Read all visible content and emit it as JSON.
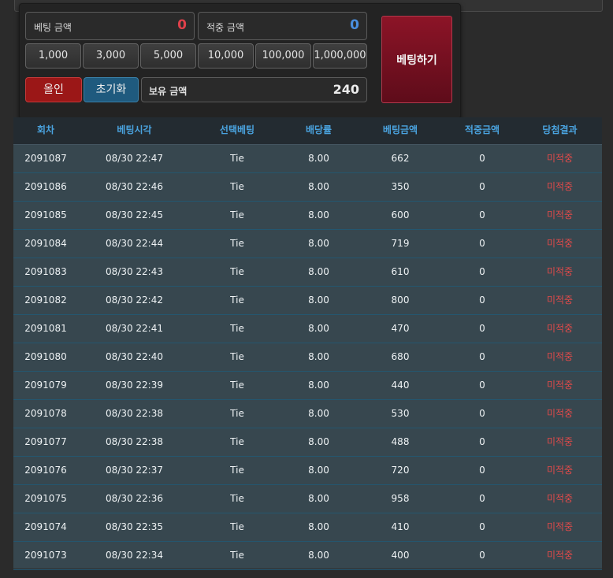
{
  "bet_form": {
    "bet_amount_label": "베팅 금액",
    "bet_amount_value": "0",
    "win_amount_label": "적중 금액",
    "win_amount_value": "0",
    "chips": [
      "1,000",
      "3,000",
      "5,000",
      "10,000",
      "100,000",
      "1,000,000"
    ],
    "allin_label": "올인",
    "reset_label": "초기화",
    "holding_label": "보유 금액",
    "holding_value": "240",
    "place_bet_label": "베팅하기",
    "colors": {
      "bet_amount": "#e0404a",
      "win_amount": "#4a8fe0",
      "place_bet": "#7a1020"
    }
  },
  "history": {
    "headers": [
      "회차",
      "베팅시각",
      "선택베팅",
      "배당률",
      "베팅금액",
      "적중금액",
      "당첨결과"
    ],
    "rows": [
      [
        "2091087",
        "08/30 22:47",
        "Tie",
        "8.00",
        "662",
        "0",
        "미적중"
      ],
      [
        "2091086",
        "08/30 22:46",
        "Tie",
        "8.00",
        "350",
        "0",
        "미적중"
      ],
      [
        "2091085",
        "08/30 22:45",
        "Tie",
        "8.00",
        "600",
        "0",
        "미적중"
      ],
      [
        "2091084",
        "08/30 22:44",
        "Tie",
        "8.00",
        "719",
        "0",
        "미적중"
      ],
      [
        "2091083",
        "08/30 22:43",
        "Tie",
        "8.00",
        "610",
        "0",
        "미적중"
      ],
      [
        "2091082",
        "08/30 22:42",
        "Tie",
        "8.00",
        "800",
        "0",
        "미적중"
      ],
      [
        "2091081",
        "08/30 22:41",
        "Tie",
        "8.00",
        "470",
        "0",
        "미적중"
      ],
      [
        "2091080",
        "08/30 22:40",
        "Tie",
        "8.00",
        "680",
        "0",
        "미적중"
      ],
      [
        "2091079",
        "08/30 22:39",
        "Tie",
        "8.00",
        "440",
        "0",
        "미적중"
      ],
      [
        "2091078",
        "08/30 22:38",
        "Tie",
        "8.00",
        "530",
        "0",
        "미적중"
      ],
      [
        "2091077",
        "08/30 22:38",
        "Tie",
        "8.00",
        "488",
        "0",
        "미적중"
      ],
      [
        "2091076",
        "08/30 22:37",
        "Tie",
        "8.00",
        "720",
        "0",
        "미적중"
      ],
      [
        "2091075",
        "08/30 22:36",
        "Tie",
        "8.00",
        "958",
        "0",
        "미적중"
      ],
      [
        "2091074",
        "08/30 22:35",
        "Tie",
        "8.00",
        "410",
        "0",
        "미적중"
      ],
      [
        "2091073",
        "08/30 22:34",
        "Tie",
        "8.00",
        "400",
        "0",
        "미적중"
      ]
    ]
  }
}
